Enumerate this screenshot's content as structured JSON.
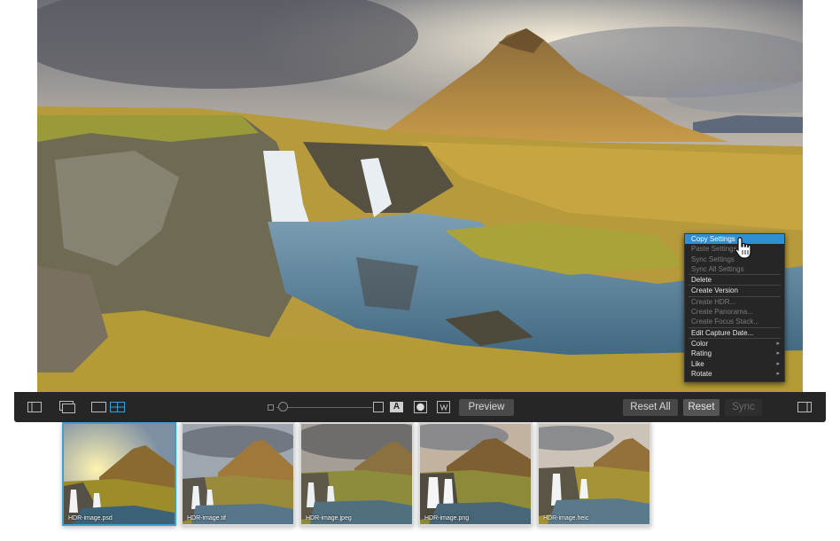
{
  "context_menu": {
    "items": [
      {
        "label": "Copy Settings",
        "state": "highlighted"
      },
      {
        "label": "Paste Settings",
        "state": "disabled"
      },
      {
        "label": "Sync Settings",
        "state": "disabled"
      },
      {
        "label": "Sync All Settings",
        "state": "disabled"
      },
      {
        "label": "Delete",
        "state": "enabled"
      },
      {
        "label": "Create Version",
        "state": "enabled"
      },
      {
        "label": "Create HDR...",
        "state": "disabled"
      },
      {
        "label": "Create Panorama...",
        "state": "disabled"
      },
      {
        "label": "Create Focus Stack...",
        "state": "disabled"
      },
      {
        "label": "Edit Capture Date...",
        "state": "enabled"
      },
      {
        "label": "Color",
        "state": "submenu"
      },
      {
        "label": "Rating",
        "state": "submenu"
      },
      {
        "label": "Like",
        "state": "submenu"
      },
      {
        "label": "Rotate",
        "state": "submenu"
      }
    ]
  },
  "toolbar": {
    "preview_label": "Preview",
    "reset_all_label": "Reset All",
    "reset_label": "Reset",
    "sync_label": "Sync",
    "text_overlay_glyph": "A"
  },
  "filmstrip": {
    "thumbnails": [
      {
        "label": "HDR-image.psd",
        "selected": true
      },
      {
        "label": "HDR-image.tif",
        "selected": false
      },
      {
        "label": "HDR-image.jpeg",
        "selected": false
      },
      {
        "label": "HDR-image.png",
        "selected": false
      },
      {
        "label": "HDR-image.heic",
        "selected": false
      }
    ]
  },
  "colors": {
    "highlight": "#2f8fd3",
    "selected_thumb_border": "#3aa1d8",
    "toolbar_bg": "#262626"
  }
}
